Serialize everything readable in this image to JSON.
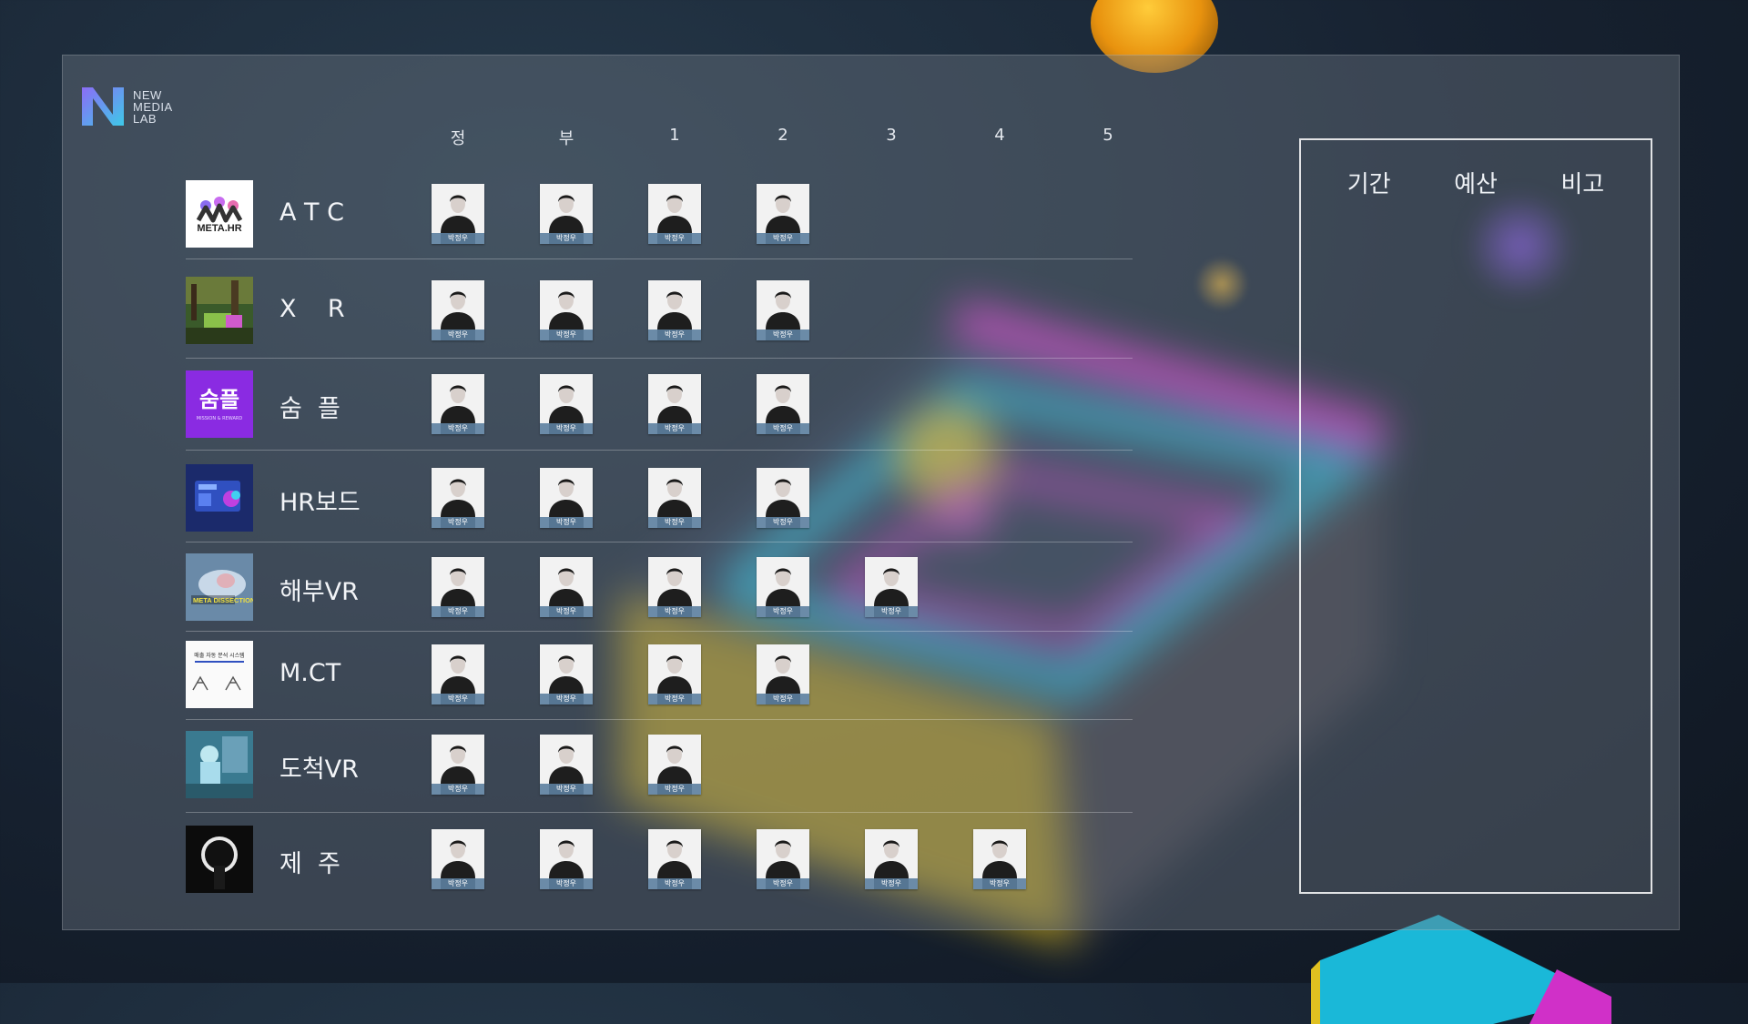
{
  "logo": {
    "line1": "NEW",
    "line2": "MEDIA",
    "line3": "LAB"
  },
  "columns": [
    "정",
    "부",
    "1",
    "2",
    "3",
    "4",
    "5"
  ],
  "rows": [
    {
      "label": "A T C",
      "thumb": "meta-hr-logo",
      "thumb_text": "META.HR",
      "assignees": [
        "박정우",
        "박정우",
        "박정우",
        "박정우"
      ]
    },
    {
      "label": "X    R",
      "thumb": "xr-scene",
      "assignees": [
        "박정우",
        "박정우",
        "박정우",
        "박정우"
      ]
    },
    {
      "label": "숨  플",
      "thumb": "sumple-logo",
      "thumb_text": "숨플",
      "thumb_sub": "MISSION & REWARD",
      "assignees": [
        "박정우",
        "박정우",
        "박정우",
        "박정우"
      ]
    },
    {
      "label": "HR보드",
      "thumb": "hr-board-screen",
      "assignees": [
        "박정우",
        "박정우",
        "박정우",
        "박정우"
      ]
    },
    {
      "label": "해부VR",
      "thumb": "meta-dissection",
      "thumb_text": "META DISSECTION",
      "assignees": [
        "박정우",
        "박정우",
        "박정우",
        "박정우",
        "박정우"
      ]
    },
    {
      "label": "M.CT",
      "thumb": "mct-doc",
      "thumb_text": "매출 자동 분석 시스템",
      "assignees": [
        "박정우",
        "박정우",
        "박정우",
        "박정우"
      ]
    },
    {
      "label": "도척VR",
      "thumb": "factory-vr",
      "assignees": [
        "박정우",
        "박정우",
        "박정우"
      ]
    },
    {
      "label": "제  주",
      "thumb": "jeju-eclipse",
      "assignees": [
        "박정우",
        "박정우",
        "박정우",
        "박정우",
        "박정우",
        "박정우"
      ]
    }
  ],
  "side_panel": {
    "headers": [
      "기간",
      "예산",
      "비고"
    ]
  },
  "colors": {
    "accent_magenta": "#e03ad6",
    "accent_cyan": "#2ec9e0",
    "accent_yellow": "#e0c020"
  }
}
